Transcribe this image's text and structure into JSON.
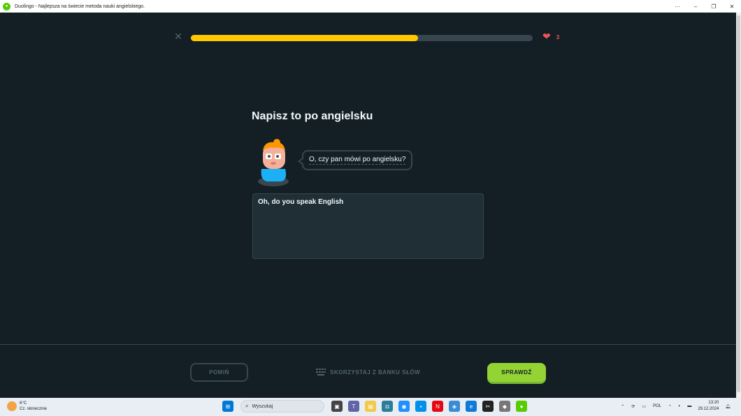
{
  "window": {
    "title": "Duolingo - Najlepsza na świecie metoda nauki angielskiego.",
    "controls": [
      "···",
      "–",
      "❐",
      "✕"
    ]
  },
  "lesson": {
    "close_symbol": "✕",
    "progress_fraction": 0.665,
    "hearts": "3",
    "heading": "Napisz to po angielsku",
    "prompt": "O, czy pan mówi po angielsku?",
    "answer_value": "Oh, do you speak English"
  },
  "footer": {
    "skip_label": "POMIŃ",
    "word_bank_label": "SKORZYSTAJ Z BANKU SŁÓW",
    "check_label": "SPRAWDŹ"
  },
  "taskbar": {
    "weather_temp": "6°C",
    "weather_desc": "Cz. słonecznie",
    "search_placeholder": "Wyszukaj",
    "language": "POL",
    "time": "13:20",
    "date": "29.12.2024"
  },
  "colors": {
    "background": "#131f24",
    "progress_fill": "#ffc800",
    "heart": "#ee5555",
    "check_button": "#93d333"
  }
}
